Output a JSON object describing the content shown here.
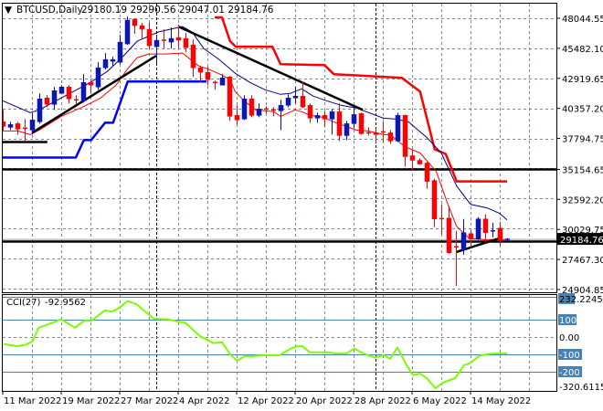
{
  "header": {
    "menu_glyph": "▼",
    "symbol_timeframe": "BTCUSD,Daily",
    "ohlc": "29180.19 29290.56 29047.01 29184.76"
  },
  "colors": {
    "bull": "#0c1aa8",
    "bear": "#ff0000",
    "ma_fast": "#ff0000",
    "ma_slow": "#000080",
    "channel_upper": "#ff0000",
    "channel_lower": "#0000ff",
    "trendline": "#000000",
    "cci": "#7cfc00",
    "cci_levels": "#4682b4",
    "grid": "#7a8796"
  },
  "chart_data": [
    {
      "type": "candlestick",
      "title": "BTCUSD,Daily",
      "ylim": [
        24590,
        49370
      ],
      "x_start_label": "11 Mar 2022",
      "x_tick_labels": [
        "11 Mar 2022",
        "19 Mar 2022",
        "27 Mar 2022",
        "4 Apr 2022",
        "12 Apr 2022",
        "20 Apr 2022",
        "28 Apr 2022",
        "6 May 2022",
        "14 May 2022"
      ],
      "x_tick_days": [
        0,
        8,
        16,
        24,
        32,
        40,
        48,
        56,
        64
      ],
      "month_separator_days": [
        21,
        51
      ],
      "y_tick_labels": [
        "48044.55",
        "45482.10",
        "42919.65",
        "40357.20",
        "37794.75",
        "35154.65",
        "32592.20",
        "30029.75",
        "27467.30",
        "24904.85"
      ],
      "current_price": "29184.76",
      "ohlc": [
        [
          39211,
          40227,
          38430,
          38820
        ],
        [
          38742,
          39211,
          38508,
          38977
        ],
        [
          39055,
          39211,
          38117,
          38586
        ],
        [
          38664,
          39446,
          37491,
          38650
        ],
        [
          38508,
          39993,
          38117,
          39368
        ],
        [
          39211,
          41635,
          39055,
          41165
        ],
        [
          41244,
          41478,
          40462,
          40696
        ],
        [
          40696,
          42181,
          40227,
          41869
        ],
        [
          41635,
          42338,
          41556,
          42181
        ],
        [
          42181,
          42338,
          40775,
          41165
        ],
        [
          41087,
          41478,
          40696,
          41050
        ],
        [
          41009,
          43276,
          40850,
          42572
        ],
        [
          42572,
          42807,
          41635,
          42338
        ],
        [
          42181,
          44293,
          41947,
          43823
        ],
        [
          43823,
          45074,
          43667,
          44527
        ],
        [
          44371,
          44762,
          43980,
          44527
        ],
        [
          44293,
          46638,
          44137,
          46012
        ],
        [
          45856,
          48200,
          45778,
          47888
        ],
        [
          47966,
          48044,
          46716,
          47419
        ],
        [
          47419,
          47654,
          46325,
          47107
        ],
        [
          47107,
          47654,
          45465,
          45700
        ],
        [
          45622,
          46638,
          44137,
          46169
        ],
        [
          46169,
          47107,
          45465,
          46140
        ],
        [
          46012,
          47263,
          45465,
          46325
        ],
        [
          46403,
          47497,
          45465,
          46169
        ],
        [
          46325,
          46794,
          45152,
          45543
        ],
        [
          45778,
          46247,
          43042,
          43823
        ],
        [
          43823,
          43980,
          42572,
          43433
        ],
        [
          43433,
          43902,
          42338,
          42807
        ],
        [
          42572,
          42729,
          41947,
          42540
        ],
        [
          42338,
          43276,
          42338,
          42963
        ],
        [
          43042,
          43120,
          39289,
          39680
        ],
        [
          39758,
          40618,
          38977,
          39368
        ],
        [
          39446,
          41478,
          39368,
          41165
        ],
        [
          41165,
          41478,
          39602,
          39758
        ],
        [
          39758,
          40775,
          39602,
          40305
        ],
        [
          40305,
          40540,
          39915,
          40280
        ],
        [
          40227,
          40462,
          39680,
          40200
        ],
        [
          40149,
          41087,
          38508,
          40618
        ],
        [
          40618,
          41556,
          40462,
          41244
        ],
        [
          41244,
          42181,
          40775,
          41400
        ],
        [
          41400,
          42651,
          40384,
          40462
        ],
        [
          40618,
          40775,
          39133,
          39523
        ],
        [
          39523,
          39993,
          39133,
          39758
        ],
        [
          39758,
          40149,
          38742,
          39446
        ],
        [
          39446,
          40305,
          38117,
          40071
        ],
        [
          40071,
          40775,
          37570,
          38038
        ],
        [
          38038,
          39289,
          37648,
          39055
        ],
        [
          39055,
          40384,
          38664,
          39836
        ],
        [
          39915,
          39993,
          38117,
          38195
        ],
        [
          38273,
          38742,
          38038,
          38250
        ],
        [
          38273,
          38664,
          37335,
          38117
        ],
        [
          38351,
          39211,
          37491,
          38330
        ],
        [
          38273,
          38508,
          37335,
          37570
        ],
        [
          37570,
          39993,
          37491,
          39758
        ],
        [
          39758,
          39836,
          35380,
          36241
        ],
        [
          36319,
          36868,
          35068,
          35928
        ],
        [
          35928,
          36084,
          35537,
          35615
        ],
        [
          35694,
          35772,
          33505,
          34130
        ],
        [
          34207,
          34364,
          30221,
          30925
        ],
        [
          30950,
          32176,
          29596,
          30925
        ],
        [
          31003,
          32020,
          27955,
          28034
        ],
        [
          28550,
          29909,
          25219,
          28502
        ],
        [
          28268,
          30925,
          27877,
          29752
        ],
        [
          29674,
          29909,
          28502,
          29205
        ],
        [
          29205,
          31080,
          29127,
          30925
        ],
        [
          30925,
          31316,
          28893,
          29752
        ],
        [
          29880,
          30612,
          29362,
          29909
        ],
        [
          30143,
          30691,
          28659,
          29127
        ],
        [
          29180.19,
          29290.56,
          29047.01,
          29184.76
        ]
      ],
      "ma_fast": [
        [
          0,
          38430
        ],
        [
          2.1,
          38430
        ],
        [
          3.75,
          38117
        ],
        [
          5,
          38508
        ],
        [
          8,
          39680
        ],
        [
          10.9,
          40462
        ],
        [
          13.4,
          41244
        ],
        [
          15.5,
          42338
        ],
        [
          17.1,
          43745
        ],
        [
          18.4,
          44683
        ],
        [
          20,
          44996
        ],
        [
          22.1,
          44996
        ],
        [
          24.6,
          45074
        ],
        [
          26.8,
          43980
        ],
        [
          28,
          43745
        ],
        [
          30,
          43198
        ],
        [
          31.1,
          42807
        ],
        [
          31.8,
          41791
        ],
        [
          33,
          41009
        ],
        [
          34.6,
          40227
        ],
        [
          37.1,
          40071
        ],
        [
          38,
          39680
        ],
        [
          40,
          40227
        ],
        [
          40.9,
          40071
        ],
        [
          42.1,
          39758
        ],
        [
          43.8,
          39602
        ],
        [
          45.9,
          39055
        ],
        [
          48.4,
          38508
        ],
        [
          50,
          38430
        ],
        [
          52.1,
          38117
        ],
        [
          53,
          38117
        ],
        [
          55,
          37101
        ],
        [
          57.1,
          36553
        ],
        [
          59.3,
          34990
        ],
        [
          60.9,
          32176
        ],
        [
          62.1,
          30300
        ],
        [
          63.8,
          29284
        ],
        [
          66.3,
          29127
        ],
        [
          67.5,
          29205
        ],
        [
          68.8,
          29127
        ]
      ],
      "ma_slow": [
        [
          0,
          41009
        ],
        [
          3.75,
          39993
        ],
        [
          5,
          40227
        ],
        [
          8,
          41244
        ],
        [
          12,
          42572
        ],
        [
          14.3,
          43511
        ],
        [
          16.3,
          44683
        ],
        [
          18.4,
          46091
        ],
        [
          21.3,
          46872
        ],
        [
          24.6,
          47341
        ],
        [
          25.9,
          46872
        ],
        [
          27.5,
          45465
        ],
        [
          29.6,
          44527
        ],
        [
          31.8,
          43354
        ],
        [
          33.8,
          42572
        ],
        [
          35.9,
          41947
        ],
        [
          38,
          41556
        ],
        [
          39.3,
          41635
        ],
        [
          40.9,
          42025
        ],
        [
          42.5,
          41400
        ],
        [
          44.3,
          41009
        ],
        [
          46.3,
          40618
        ],
        [
          48.4,
          40384
        ],
        [
          52.1,
          39524
        ],
        [
          53.8,
          39446
        ],
        [
          55.5,
          39211
        ],
        [
          58,
          37882
        ],
        [
          60,
          36553
        ],
        [
          62.1,
          33740
        ],
        [
          64,
          32176
        ],
        [
          66.3,
          31863
        ],
        [
          68,
          31394
        ],
        [
          69,
          30847
        ]
      ],
      "channel_upper": [
        [
          29,
          48123
        ],
        [
          30,
          48123
        ],
        [
          31.1,
          46091
        ],
        [
          31.9,
          45621
        ],
        [
          36.9,
          45621
        ],
        [
          38,
          44137
        ],
        [
          44,
          44058
        ],
        [
          45.3,
          43276
        ],
        [
          54.6,
          42963
        ],
        [
          57.1,
          41791
        ],
        [
          59.1,
          36866
        ],
        [
          60.6,
          36475
        ],
        [
          62.1,
          34130
        ],
        [
          69,
          34130
        ]
      ],
      "channel_lower": [
        [
          0,
          36163
        ],
        [
          10,
          36163
        ],
        [
          11.1,
          37648
        ],
        [
          12.1,
          37648
        ],
        [
          14,
          39133
        ],
        [
          15.1,
          39133
        ],
        [
          17.1,
          42651
        ],
        [
          27.9,
          42651
        ]
      ],
      "trendlines": [
        [
          [
            4,
            38273
          ],
          [
            21,
            44839
          ]
        ],
        [
          [
            24,
            47341
          ],
          [
            49.25,
            40227
          ]
        ],
        [
          [
            62.1,
            28112
          ],
          [
            68,
            29284
          ]
        ],
        [
          [
            0,
            37491
          ],
          [
            6.1,
            37491
          ]
        ]
      ],
      "horizontal_lines": [
        35154.65,
        29035
      ]
    },
    {
      "type": "line",
      "title": "CCI(27)",
      "last_value_label": "-92.9562",
      "ylim": [
        -324,
        249
      ],
      "y_tick_labels": [
        "232.2245",
        "100",
        "0.00",
        "-100",
        "-200",
        "-320.6115"
      ],
      "levels": [
        232.2245,
        100,
        -100,
        -200
      ],
      "points": [
        [
          0.1,
          -40
        ],
        [
          2,
          -53
        ],
        [
          3.2,
          -44
        ],
        [
          4.1,
          -23
        ],
        [
          4.9,
          53
        ],
        [
          6.3,
          74
        ],
        [
          8,
          102
        ],
        [
          9.9,
          53
        ],
        [
          11.1,
          93
        ],
        [
          12.1,
          93
        ],
        [
          14,
          154
        ],
        [
          14.9,
          146
        ],
        [
          15.9,
          167
        ],
        [
          17.1,
          207
        ],
        [
          18.3,
          189
        ],
        [
          20.7,
          105
        ],
        [
          22.6,
          102
        ],
        [
          24.1,
          88
        ],
        [
          25,
          82
        ],
        [
          27,
          4
        ],
        [
          28.8,
          -35
        ],
        [
          30,
          -30
        ],
        [
          31.2,
          -105
        ],
        [
          32.1,
          -137
        ],
        [
          33.1,
          -109
        ],
        [
          34.1,
          -112
        ],
        [
          35,
          -107
        ],
        [
          37.9,
          -105
        ],
        [
          39.4,
          -67
        ],
        [
          40.3,
          -53
        ],
        [
          41,
          -53
        ],
        [
          42,
          -88
        ],
        [
          44.6,
          -88
        ],
        [
          45.6,
          -95
        ],
        [
          47,
          -95
        ],
        [
          48.1,
          -67
        ],
        [
          49.4,
          -96
        ],
        [
          50.9,
          -119
        ],
        [
          52.1,
          -105
        ],
        [
          53,
          -126
        ],
        [
          54,
          -61
        ],
        [
          55.2,
          -158
        ],
        [
          56.1,
          -219
        ],
        [
          57.1,
          -211
        ],
        [
          58,
          -237
        ],
        [
          59.2,
          -295
        ],
        [
          60.2,
          -263
        ],
        [
          61.9,
          -237
        ],
        [
          63.1,
          -163
        ],
        [
          64,
          -149
        ],
        [
          65.2,
          -109
        ],
        [
          66.7,
          -96
        ],
        [
          69,
          -93
        ]
      ]
    }
  ]
}
